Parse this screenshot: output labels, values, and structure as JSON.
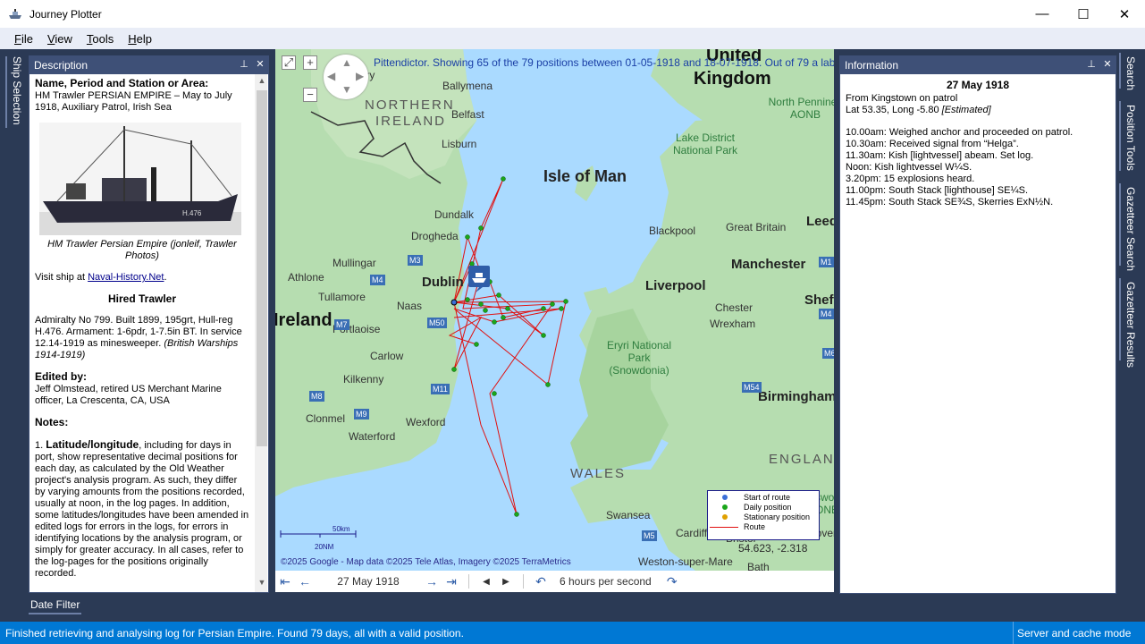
{
  "window": {
    "title": "Journey Plotter",
    "controls": {
      "minimize": "—",
      "maximize": "☐",
      "close": "✕"
    }
  },
  "menu": [
    "File",
    "View",
    "Tools",
    "Help"
  ],
  "left_tabs": [
    "Ship Selection"
  ],
  "right_tabs": [
    "Search",
    "Position Tools",
    "Gazetteer Search",
    "Gazetteer Results"
  ],
  "description": {
    "header": "Description",
    "name_heading": "Name, Period and Station or Area:",
    "name_text": "HM Trawler PERSIAN EMPIRE – May to July 1918, Auxiliary Patrol, Irish Sea",
    "photo_caption": "HM Trawler Persian Empire (jonleif, Trawler Photos)",
    "visit_prefix": "Visit ship at ",
    "visit_link": "Naval-History.Net",
    "visit_suffix": ".",
    "type_heading": "Hired Trawler",
    "type_text": "Admiralty No 799. Built 1899, 195grt, Hull-reg H.476. Armament: 1-6pdr, 1-7.5in BT. In service 12.14-1919 as minesweeper.",
    "type_source": "(British Warships 1914-1919)",
    "edited_heading": "Edited by:",
    "edited_text": "Jeff Olmstead, retired US Merchant Marine officer, La Crescenta, CA, USA",
    "notes_heading": "Notes:",
    "notes_num": "1. ",
    "notes_bold": "Latitude/longitude",
    "notes_text": ", including for days in port, show representative decimal positions for each day, as calculated by the Old Weather project's analysis program. As such, they differ by varying amounts from the positions recorded, usually at noon, in the log pages. In addition, some latitudes/longitudes have been amended in edited logs for errors in the logs, for errors in identifying locations by the analysis program, or simply for greater accuracy. In all cases, refer to the log-pages for the positions originally recorded."
  },
  "map": {
    "info": "Pittendictor. Showing 65 of the 79 positions between 01-05-1918 and 18-07-1918. Out of 79 a label",
    "credit": "©2025 Google - Map data ©2025 Tele Atlas, Imagery ©2025 TerraMetrics",
    "scale_top": "50km",
    "scale_bottom": "20NM",
    "coords": "54.623, -2.318",
    "legend": [
      {
        "label": "Start of route",
        "color": "#3c6fd8",
        "kind": "dot"
      },
      {
        "label": "Daily position",
        "color": "#1aa61a",
        "kind": "dot"
      },
      {
        "label": "Stationary position",
        "color": "#e0a000",
        "kind": "dot"
      },
      {
        "label": "Route",
        "color": "#e01010",
        "kind": "line"
      }
    ],
    "places": [
      {
        "name": "Derry",
        "cls": "p"
      },
      {
        "name": "Ballymena",
        "cls": "p"
      },
      {
        "name": "NORTHERN",
        "cls": "region"
      },
      {
        "name": "IRELAND",
        "cls": "region"
      },
      {
        "name": "Belfast",
        "cls": "p"
      },
      {
        "name": "Lisburn",
        "cls": "p"
      },
      {
        "name": "United",
        "cls": "country"
      },
      {
        "name": "Kingdom",
        "cls": "country"
      },
      {
        "name": "Isle of Man",
        "cls": "big"
      },
      {
        "name": "Lake District National Park",
        "cls": "park"
      },
      {
        "name": "North Pennines AONB",
        "cls": "park"
      },
      {
        "name": "Dundalk",
        "cls": "p"
      },
      {
        "name": "Drogheda",
        "cls": "p"
      },
      {
        "name": "Mullingar",
        "cls": "p"
      },
      {
        "name": "Athlone",
        "cls": "p"
      },
      {
        "name": "Tullamore",
        "cls": "p"
      },
      {
        "name": "Dublin",
        "cls": "bigp"
      },
      {
        "name": "Naas",
        "cls": "p"
      },
      {
        "name": "Ireland",
        "cls": "country"
      },
      {
        "name": "Portlaoise",
        "cls": "p"
      },
      {
        "name": "Carlow",
        "cls": "p"
      },
      {
        "name": "Kilkenny",
        "cls": "p"
      },
      {
        "name": "Clonmel",
        "cls": "p"
      },
      {
        "name": "Wexford",
        "cls": "p"
      },
      {
        "name": "Waterford",
        "cls": "p"
      },
      {
        "name": "Blackpool",
        "cls": "p"
      },
      {
        "name": "Great Britain",
        "cls": "p"
      },
      {
        "name": "Leeds",
        "cls": "bigp"
      },
      {
        "name": "Manchester",
        "cls": "bigp"
      },
      {
        "name": "Liverpool",
        "cls": "bigp"
      },
      {
        "name": "Sheffield",
        "cls": "bigp"
      },
      {
        "name": "Chester",
        "cls": "p"
      },
      {
        "name": "Wrexham",
        "cls": "p"
      },
      {
        "name": "Eryri National Park (Snowdonia)",
        "cls": "park"
      },
      {
        "name": "Birmingham",
        "cls": "bigp"
      },
      {
        "name": "WALES",
        "cls": "region"
      },
      {
        "name": "ENGLAND",
        "cls": "region"
      },
      {
        "name": "Swansea",
        "cls": "p"
      },
      {
        "name": "Cardiff",
        "cls": "p"
      },
      {
        "name": "Bristol",
        "cls": "p"
      },
      {
        "name": "Weston-super-Mare",
        "cls": "p"
      },
      {
        "name": "Bath",
        "cls": "p"
      },
      {
        "name": "Cotswolds AONB",
        "cls": "park"
      },
      {
        "name": "Coventry",
        "cls": "p"
      }
    ],
    "roads": [
      "M3",
      "M4",
      "M7",
      "M9",
      "M8",
      "M11",
      "M1",
      "M6",
      "M54",
      "M5",
      "M4",
      "M50"
    ]
  },
  "playback": {
    "date": "27 May 1918",
    "speed": "6 hours per second"
  },
  "information": {
    "header": "Information",
    "date": "27 May 1918",
    "from": "From Kingstown on patrol",
    "latlong_prefix": "Lat 53.35, Long -5.80 ",
    "latlong_estimated": "[Estimated]",
    "log": [
      "10.00am: Weighed anchor and proceeded on patrol.",
      "10.30am: Received signal from “Helga”.",
      "11.30am: Kish [lightvessel] abeam. Set log.",
      "Noon: Kish lightvessel W¼S.",
      "3.20pm: 15 explosions heard.",
      "11.00pm: South Stack [lighthouse] SE¼S.",
      "11.45pm: South Stack SE¾S, Skerries ExN½N."
    ]
  },
  "date_filter": "Date Filter",
  "status": {
    "message": "Finished retrieving and analysing log for Persian Empire. Found 79 days, all with a valid position.",
    "mode": "Server and cache mode"
  }
}
